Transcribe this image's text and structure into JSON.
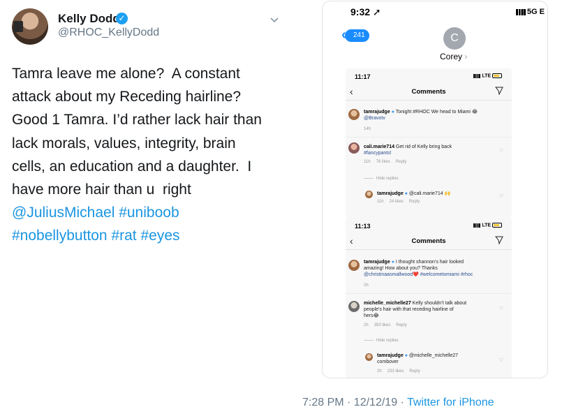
{
  "tweet": {
    "name": "Kelly Dodd",
    "handle": "@RHOC_KellyDodd",
    "lines": [
      "Tamra leave me alone?  A constant",
      "attack about my Receding hairline?",
      "Good 1 Tamra. I’d rather lack hair than",
      "lack morals, values, integrity, brain",
      "cells, an education and a daughter.  I",
      "have more hair than u  right"
    ],
    "links_line1": "@JuliusMichael #uniboob",
    "links_line2": "#nobellybutton #rat #eyes",
    "timestamp": "7:28 PM · 12/12/19 · ",
    "source": "Twitter for iPhone"
  },
  "phone": {
    "time": "9:32",
    "network": "5G E",
    "back_count": "241",
    "contact_initial": "C",
    "contact_name": "Corey"
  },
  "insta1": {
    "time": "11:17",
    "network": "LTE",
    "title": "Comments",
    "post": {
      "user": "tamrajudge",
      "text": " Tonight #RHOC We head to Miami 😂",
      "tag": "@Bravotv",
      "age": "14h"
    },
    "comment": {
      "user": "cali.marie714",
      "text": " Get rid of Kelly bring back",
      "tag": "#fancypants!",
      "age": "11h",
      "likes": "76 likes",
      "reply": "Reply"
    },
    "hide_replies": "Hide replies",
    "reply": {
      "user": "tamrajudge",
      "text": " @cali.marie714 🙌",
      "age": "11h",
      "likes": "24 likes",
      "reply": "Reply"
    }
  },
  "insta2": {
    "time": "11:13",
    "network": "LTE",
    "title": "Comments",
    "post": {
      "user": "tamrajudge",
      "text1": " I thought shannon’s hair looked",
      "text2": "amazing!  How about you? Thanks",
      "tag": "@christinaasmallwood❤️ #welcometomiami #rhoc",
      "age": "2h"
    },
    "comment": {
      "user": "michelle_michelle27",
      "text1": " Kelly shouldn’t talk about",
      "text2": "people's hair with that  receding hairline of",
      "text3": "hers😂",
      "age": "2h",
      "likes": "393 likes",
      "reply": "Reply"
    },
    "hide_replies": "Hide replies",
    "reply": {
      "user": "tamrajudge",
      "text1": " @michelle_michelle27",
      "text2": "combover",
      "age": "2h",
      "likes": "233 likes",
      "reply": "Reply"
    }
  }
}
